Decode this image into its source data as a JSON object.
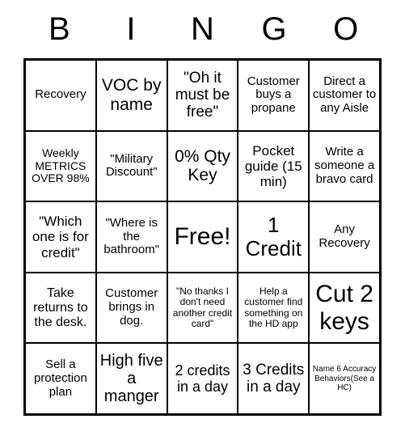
{
  "header": [
    "B",
    "I",
    "N",
    "G",
    "O"
  ],
  "cells": [
    [
      "Recovery",
      "VOC by name",
      "\"Oh it must be free\"",
      "Customer buys a propane",
      "Direct a customer to any Aisle"
    ],
    [
      "Weekly METRICS OVER 98%",
      "\"Military Discount\"",
      "0% Qty Key",
      "Pocket guide (15 min)",
      "Write a someone a bravo card"
    ],
    [
      "\"Which one is for credit\"",
      "\"Where is the bathroom\"",
      "Free!",
      "1 Credit",
      "Any Recovery"
    ],
    [
      "Take returns to the desk.",
      "Customer brings in dog.",
      "\"No thanks I don't need another credit card\"",
      "Help a customer find something on the HD app",
      "Cut 2 keys"
    ],
    [
      "Sell a protection plan",
      "High five a manger",
      "2 credits in a day",
      "3 Credits in a day",
      "Name 6 Accuracy Behaviors(See a HC)"
    ]
  ]
}
